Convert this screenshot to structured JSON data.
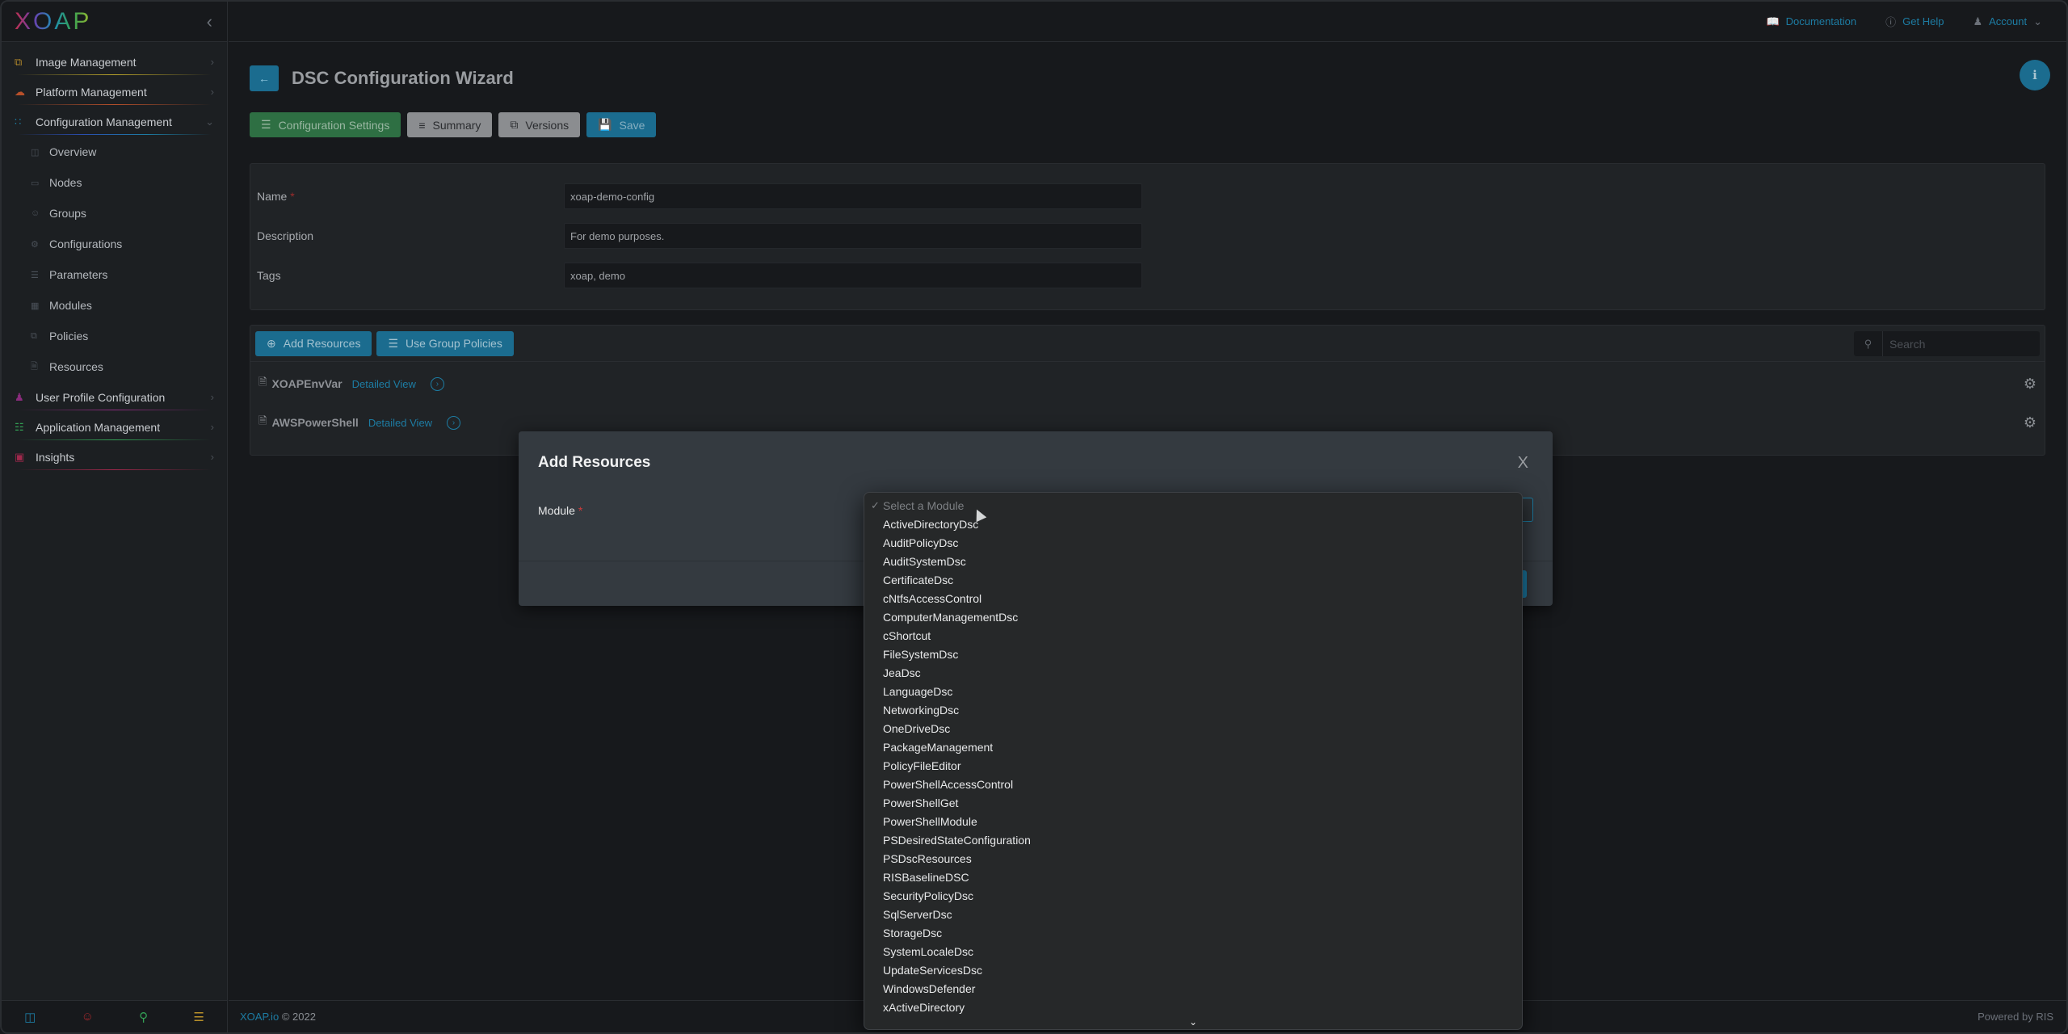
{
  "brand": {
    "logo_text": "XOAP",
    "collapse_icon": "chevron-left-icon"
  },
  "sidebar": {
    "groups": [
      {
        "label": "Image Management",
        "icon": "copy-icon",
        "color": "#b0872a",
        "line": "#b8a32a"
      },
      {
        "label": "Platform Management",
        "icon": "cloud-icon",
        "color": "#b8502a",
        "line": "#b8502a"
      },
      {
        "label": "Configuration Management",
        "icon": "grid-dots-icon",
        "color": "#1d7ca3",
        "line": "#2a5db0",
        "expanded": true
      },
      {
        "label": "User Profile Configuration",
        "icon": "user-icon",
        "color": "#8a2c7d",
        "line": "#8a2c7d"
      },
      {
        "label": "Application Management",
        "icon": "sitemap-icon",
        "color": "#33a055",
        "line": "#33a055"
      },
      {
        "label": "Insights",
        "icon": "monitor-icon",
        "color": "#a0284c",
        "line": "#a0284c"
      }
    ],
    "sub_items": [
      {
        "label": "Overview",
        "icon": "layout-icon"
      },
      {
        "label": "Nodes",
        "icon": "laptop-icon"
      },
      {
        "label": "Groups",
        "icon": "users-icon"
      },
      {
        "label": "Configurations",
        "icon": "gear-icon"
      },
      {
        "label": "Parameters",
        "icon": "list-icon"
      },
      {
        "label": "Modules",
        "icon": "modules-icon"
      },
      {
        "label": "Policies",
        "icon": "stack-icon"
      },
      {
        "label": "Resources",
        "icon": "file-icon"
      }
    ],
    "footer_icons": [
      {
        "name": "layout-icon",
        "color": "#1d7ca3"
      },
      {
        "name": "users-icon",
        "color": "#a0282c"
      },
      {
        "name": "map-pin-icon",
        "color": "#33a055"
      },
      {
        "name": "list-icon",
        "color": "#b8902a"
      }
    ]
  },
  "topbar": {
    "documentation": "Documentation",
    "get_help": "Get Help",
    "account": "Account"
  },
  "page": {
    "title": "DSC Configuration Wizard",
    "info_label": "i"
  },
  "toolbar": {
    "configuration_settings": "Configuration Settings",
    "summary": "Summary",
    "versions": "Versions",
    "save": "Save"
  },
  "form": {
    "name_label": "Name",
    "name_value": "xoap-demo-config",
    "description_label": "Description",
    "description_value": "For demo purposes.",
    "tags_label": "Tags",
    "tags_value": "xoap, demo",
    "required_mark": "*"
  },
  "resources": {
    "add_resources": "Add Resources",
    "use_group_policies": "Use Group Policies",
    "search_placeholder": "Search",
    "items": [
      {
        "name": "XOAPEnvVar",
        "link": "Detailed View"
      },
      {
        "name": "AWSPowerShell",
        "link": "Detailed View"
      }
    ]
  },
  "footer": {
    "brand_link": "XOAP.io",
    "copyright": "© 2022",
    "powered_by": "Powered by RIS"
  },
  "modal": {
    "title": "Add Resources",
    "close": "X",
    "module_label": "Module",
    "required_mark": "*"
  },
  "dropdown": {
    "placeholder": "Select a Module",
    "selected_check": "✓",
    "options": [
      "ActiveDirectoryDsc",
      "AuditPolicyDsc",
      "AuditSystemDsc",
      "CertificateDsc",
      "cNtfsAccessControl",
      "ComputerManagementDsc",
      "cShortcut",
      "FileSystemDsc",
      "JeaDsc",
      "LanguageDsc",
      "NetworkingDsc",
      "OneDriveDsc",
      "PackageManagement",
      "PolicyFileEditor",
      "PowerShellAccessControl",
      "PowerShellGet",
      "PowerShellModule",
      "PSDesiredStateConfiguration",
      "PSDscResources",
      "RISBaselineDSC",
      "SecurityPolicyDsc",
      "SqlServerDsc",
      "StorageDsc",
      "SystemLocaleDsc",
      "UpdateServicesDsc",
      "WindowsDefender",
      "xActiveDirectory"
    ],
    "more_indicator": "⌄"
  }
}
